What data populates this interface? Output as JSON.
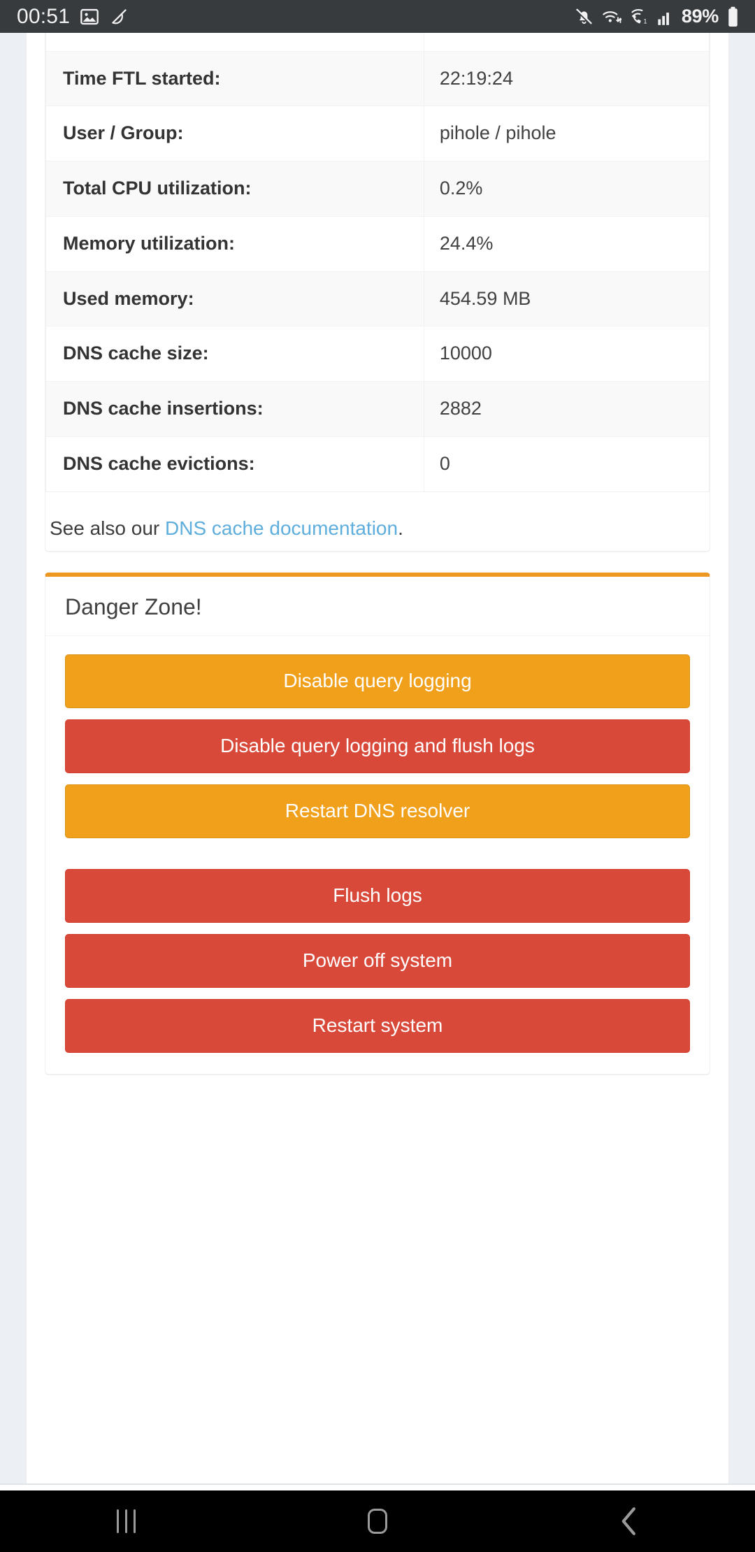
{
  "status_bar": {
    "time": "00:51",
    "battery_percent": "89%",
    "icons": {
      "left": [
        "image-icon",
        "pen-tool-icon"
      ],
      "right": [
        "bell-muted-icon",
        "wifi-icon",
        "call-icon",
        "signal-bars-icon",
        "battery-icon"
      ]
    }
  },
  "ftl_card": {
    "table": {
      "rows": [
        {
          "key": "",
          "value": "",
          "cut_off": true
        },
        {
          "key": "Time FTL started:",
          "value": "22:19:24"
        },
        {
          "key": "User / Group:",
          "value": "pihole / pihole"
        },
        {
          "key": "Total CPU utilization:",
          "value": "0.2%"
        },
        {
          "key": "Memory utilization:",
          "value": "24.4%"
        },
        {
          "key": "Used memory:",
          "value": "454.59 MB"
        },
        {
          "key": "DNS cache size:",
          "value": "10000"
        },
        {
          "key": "DNS cache insertions:",
          "value": "2882"
        },
        {
          "key": "DNS cache evictions:",
          "value": "0"
        }
      ]
    },
    "note": {
      "prefix": "See also our ",
      "link_text": "DNS cache documentation",
      "suffix": "."
    }
  },
  "danger_zone": {
    "title": "Danger Zone!",
    "accent_color": "#ec971f",
    "buttons": [
      {
        "label": "Disable query logging",
        "style": "warning"
      },
      {
        "label": "Disable query logging and flush logs",
        "style": "danger"
      },
      {
        "label": "Restart DNS resolver",
        "style": "warning",
        "gap_after": true
      },
      {
        "label": "Flush logs",
        "style": "danger"
      },
      {
        "label": "Power off system",
        "style": "danger"
      },
      {
        "label": "Restart system",
        "style": "danger",
        "last": true
      }
    ]
  },
  "nav_bar": {
    "buttons": [
      {
        "name": "recents",
        "icon": "recents-icon"
      },
      {
        "name": "home",
        "icon": "home-icon"
      },
      {
        "name": "back",
        "icon": "back-chevron-icon"
      }
    ]
  },
  "colors": {
    "page_background": "#eceff3",
    "warning": "#f0a01b",
    "danger": "#d9493a",
    "link": "#5eaedd",
    "status_bar": "#373b3e"
  }
}
